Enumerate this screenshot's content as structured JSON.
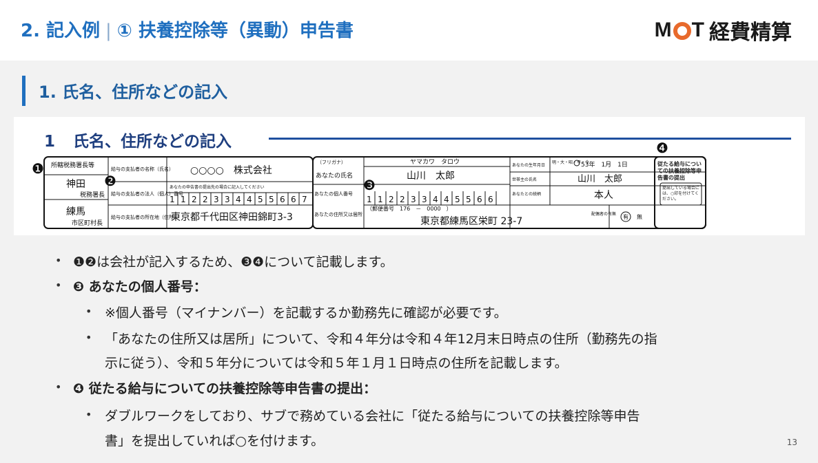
{
  "slide": {
    "title_prefix": "2. 記入例",
    "title_sep": "|",
    "title_main": "① 扶養控除等（異動）申告書",
    "logo_m": "M",
    "logo_t": "T",
    "logo_jp": "経費精算",
    "section_heading": "1. 氏名、住所などの記入",
    "page_number": "13"
  },
  "form": {
    "heading_num": "1",
    "heading_text": "氏名、住所などの記入",
    "markers": [
      "❶",
      "❷",
      "❸",
      "❹"
    ],
    "tax_office_label": "所轄税務署長等",
    "tax_office_name": "神田",
    "tax_office_suffix": "税務署長",
    "city_name": "練馬",
    "city_suffix": "市区町村長",
    "payer_name_label": "給与の支払者の名称（氏名）",
    "payer_name": "○○○○　株式会社",
    "payer_number_label": "給与の支払者の法人（個人）番号",
    "payer_number_note": "あなたの申告書の提出先の場合に記入してください",
    "payer_number_digits": [
      "1",
      "1",
      "2",
      "2",
      "3",
      "3",
      "4",
      "4",
      "5",
      "5",
      "6",
      "6",
      "7"
    ],
    "payer_address_label": "給与の支払者の所在地（住所）",
    "payer_address": "東京都千代田区神田錦町3-3",
    "furigana_label": "（フリガナ）",
    "furigana": "ヤマカワ　タロウ",
    "your_name_label": "あなたの氏名",
    "your_name": "山川　太郎",
    "your_number_label": "あなたの個人番号",
    "your_number_digits": [
      "1",
      "1",
      "2",
      "2",
      "3",
      "3",
      "4",
      "4",
      "5",
      "5",
      "6",
      "6"
    ],
    "your_address_label": "あなたの住所又は居所",
    "postal_label": "（郵便番号　176　－　0000　）",
    "your_address": "東京都練馬区栄町 23-7",
    "birthdate_label": "あなたの生年月日",
    "birthdate_era": "明・大・昭・平・令",
    "birthdate_value": "53年　1月　1日",
    "householder_label": "世帯主の氏名",
    "householder": "山川　太郎",
    "relation_label": "あなたとの続柄",
    "relation": "本人",
    "spouse_label": "配偶者の有無",
    "spouse_yes": "有",
    "spouse_no": "無",
    "secondary_title": "従たる給与についての扶養控除等申告書の提出",
    "secondary_note": "提出している場合には、○印を付けてください。"
  },
  "bullets": {
    "b1": "❶❷は会社が記入するため、❸❹について記載します。",
    "b2": "❸ あなたの個人番号：",
    "b2_1": "※個人番号（マイナンバー）を記載するか勤務先に確認が必要です。",
    "b2_2a": "「あなたの住所又は居所」について、令和４年分は令和４年12月末日時点の住所（勤務先の指",
    "b2_2b": "示に従う）、令和５年分については令和５年１月１日時点の住所を記載します。",
    "b3": "❹ 従たる給与についての扶養控除等申告書の提出：",
    "b3_1a": "ダブルワークをしており、サブで務めている会社に「従たる給与についての扶養控除等申告",
    "b3_1b": "書」を提出していれば○を付けます。"
  }
}
